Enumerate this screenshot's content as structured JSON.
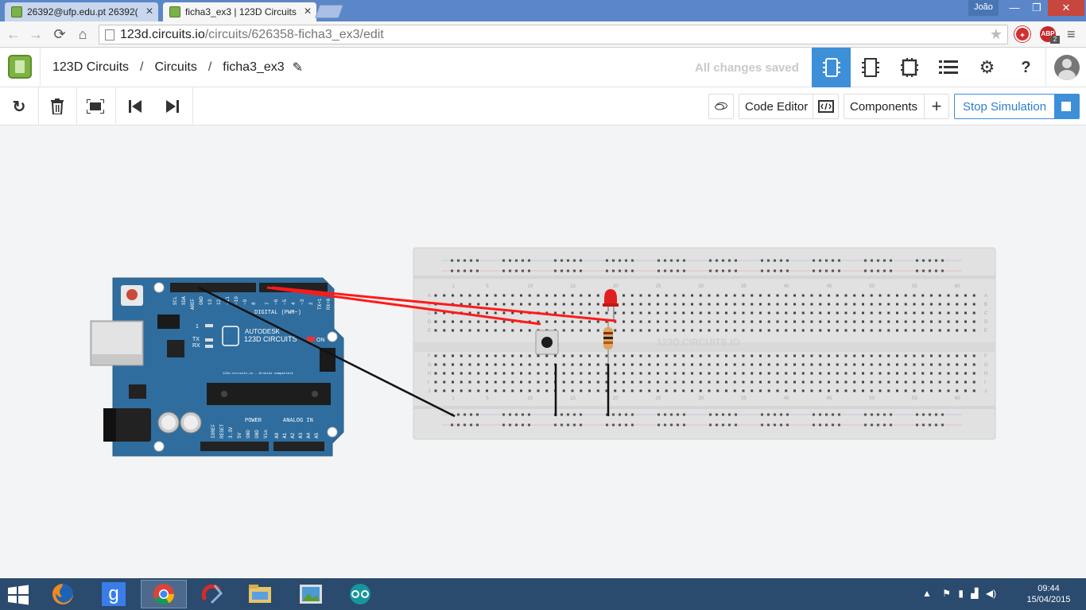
{
  "browser": {
    "tabs": [
      {
        "title": "26392@ufp.edu.pt 26392(",
        "active": false
      },
      {
        "title": "ficha3_ex3 | 123D Circuits",
        "active": true
      }
    ],
    "user": "João",
    "url_host": "123d.circuits.io",
    "url_path": "/circuits/626358-ficha3_ex3/edit",
    "extensions": [
      "ABP"
    ],
    "extension_badge": "2"
  },
  "header": {
    "app_name": "123D Circuits",
    "crumb_circuits": "Circuits",
    "circuit_name": "ficha3_ex3",
    "saved_status": "All changes saved"
  },
  "toolbar": {
    "code_editor": "Code Editor",
    "components": "Components",
    "stop_simulation": "Stop Simulation"
  },
  "arduino": {
    "brand": "AUTODESK",
    "name": "123D CIRCUITS",
    "subtitle": "123d.circuits.io - Arduino compatible",
    "digital_label": "DIGITAL (PWM~)",
    "power_label": "POWER",
    "analog_label": "ANALOG IN",
    "on_label": "ON",
    "tx_label": "TX",
    "rx_label": "RX",
    "l_label": "1",
    "top_pins": [
      "SCL",
      "SDA",
      "AREF",
      "GND",
      "13",
      "12",
      "~11",
      "~10",
      "~9",
      "8",
      "7",
      "~6",
      "~5",
      "4",
      "~3",
      "2",
      "TX+1",
      "RX+0"
    ],
    "power_pins": [
      "IOREF",
      "RESET",
      "3.3V",
      "5V",
      "GND",
      "GND",
      "Vin"
    ],
    "analog_pins": [
      "A0",
      "A1",
      "A2",
      "A3",
      "A4",
      "A5"
    ]
  },
  "breadboard": {
    "watermark": "123D.CIRCUITS.IO",
    "column_numbers": [
      "1",
      "5",
      "10",
      "15",
      "20",
      "25",
      "30",
      "35",
      "40",
      "45",
      "50",
      "55",
      "60"
    ],
    "rows_top": [
      "A",
      "B",
      "C",
      "D",
      "E"
    ],
    "rows_bottom": [
      "F",
      "G",
      "H",
      "I",
      "J"
    ]
  },
  "taskbar": {
    "time": "09:44",
    "date": "15/04/2015"
  },
  "colors": {
    "active_blue": "#3d8fd8",
    "arduino_blue": "#2f6d9e",
    "wire_red": "#ff1a1a",
    "wire_black": "#111111"
  }
}
